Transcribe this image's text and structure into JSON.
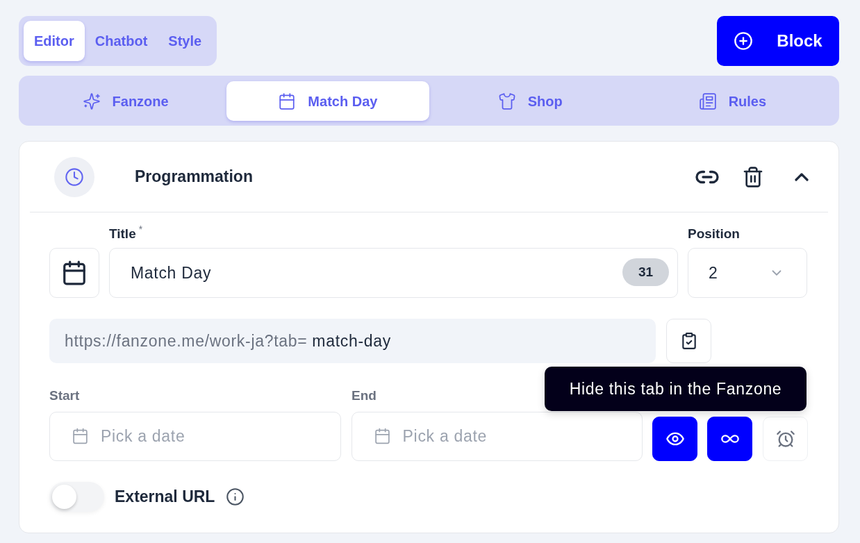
{
  "mode_tabs": [
    {
      "label": "Editor",
      "selected": true
    },
    {
      "label": "Chatbot",
      "selected": false
    },
    {
      "label": "Style",
      "selected": false
    }
  ],
  "add_button": {
    "label": "Block"
  },
  "section_tabs": [
    {
      "label": "Fanzone",
      "selected": false
    },
    {
      "label": "Match Day",
      "selected": true
    },
    {
      "label": "Shop",
      "selected": false
    },
    {
      "label": "Rules",
      "selected": false
    }
  ],
  "section": {
    "title": "Programmation",
    "expanded": true
  },
  "title_field": {
    "label": "Title",
    "required_mark": "*",
    "value": "Match Day",
    "count": "31"
  },
  "position_field": {
    "label": "Position",
    "value": "2"
  },
  "url": {
    "prefix": "https://fanzone.me/work-ja?tab=",
    "slug": "match-day"
  },
  "start": {
    "label": "Start",
    "placeholder": "Pick a date"
  },
  "end": {
    "label": "End",
    "placeholder": "Pick a date"
  },
  "schedule_buttons": [
    {
      "on": true
    },
    {
      "on": true
    },
    {
      "on": false
    }
  ],
  "tooltip": {
    "text": "Hide this tab in the Fanzone"
  },
  "external_url": {
    "label": "External URL",
    "on": false
  }
}
